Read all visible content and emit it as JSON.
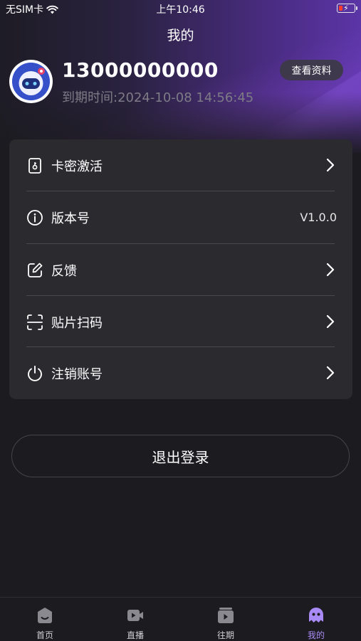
{
  "status_bar": {
    "carrier": "无SIM卡",
    "time": "上午10:46"
  },
  "header": {
    "title": "我的"
  },
  "profile": {
    "phone": "13000000000",
    "expire": "到期时间:2024-10-08 14:56:45",
    "view_button": "查看资料"
  },
  "menu": {
    "items": [
      {
        "label": "卡密激活",
        "icon": "card-key-icon"
      },
      {
        "label": "版本号",
        "icon": "info-icon",
        "value": "V1.0.0"
      },
      {
        "label": "反馈",
        "icon": "edit-icon"
      },
      {
        "label": "贴片扫码",
        "icon": "scan-icon"
      },
      {
        "label": "注销账号",
        "icon": "power-icon"
      }
    ]
  },
  "logout_button": "退出登录",
  "tabbar": {
    "items": [
      {
        "label": "首页",
        "icon": "home-icon"
      },
      {
        "label": "直播",
        "icon": "live-icon"
      },
      {
        "label": "往期",
        "icon": "archive-icon"
      },
      {
        "label": "我的",
        "icon": "profile-icon",
        "active": true
      }
    ]
  },
  "colors": {
    "background": "#1c1b20",
    "card": "#2b2a2f",
    "accent": "#a98bf5",
    "gradient_end": "#5b35a6"
  }
}
